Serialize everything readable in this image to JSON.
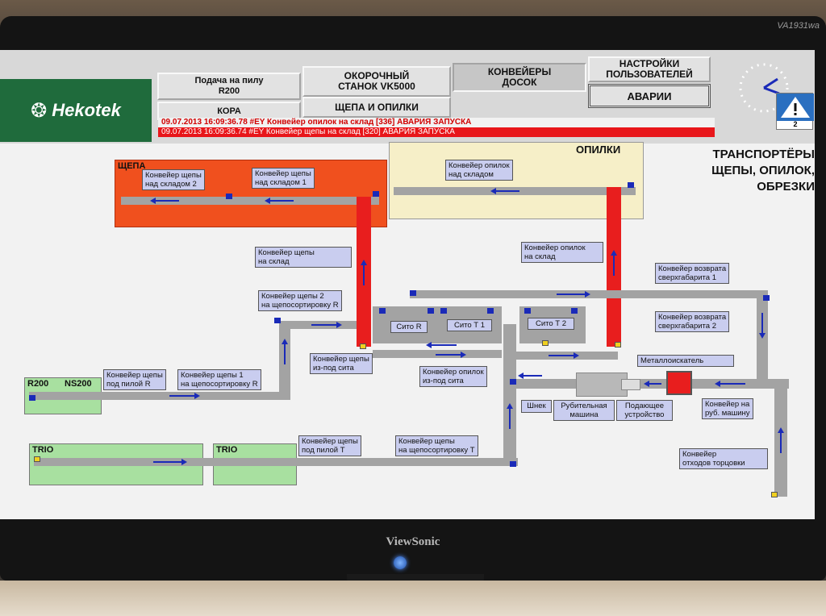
{
  "monitor": {
    "model": "VA1931wa",
    "brand": "ViewSonic"
  },
  "logo": {
    "text": "Hekotek",
    "icon": "hekotek-logo-mark"
  },
  "nav": {
    "feed_saw": "Подача на пилу\nR200",
    "debarker": "ОКОРОЧНЫЙ\nСТАНОК VK5000",
    "board_conveyors": "КОНВЕЙЕРЫ\nДОСОК",
    "user_settings": "НАСТРОЙКИ\nПОЛЬЗОВАТЕЛЕЙ",
    "bark": "КОРА",
    "chips_sawdust": "ЩЕПА И ОПИЛКИ",
    "alarms": "АВАРИИ"
  },
  "warning": {
    "icon": "warning-triangle-icon",
    "count": "2"
  },
  "alarms_list": [
    "09.07.2013 16:09:36.78 #EY Конвейер опилок на склад [336] АВАРИЯ ЗАПУСКА",
    "09.07.2013 16:09:36.74 #EY Конвейер щепы на склад [320] АВАРИЯ ЗАПУСКА"
  ],
  "title": "ТРАНСПОРТЁРЫ\nЩЕПЫ, ОПИЛОК,\nОБРЕЗКИ",
  "zones": {
    "chips": "ЩЕПА",
    "sawdust": "ОПИЛКИ",
    "r200": "R200",
    "ns200": "NS200",
    "trio1": "TRIO",
    "trio2": "TRIO"
  },
  "labels": {
    "chips_over_store2": "Конвейер щепы\nнад складом 2",
    "chips_over_store1": "Конвейер щепы\nнад складом 1",
    "sawdust_over_store": "Конвейер опилок\nнад складом",
    "chips_to_store": "Конвейер щепы\nна склад",
    "sawdust_to_store": "Конвейер опилок\nна склад",
    "chips2_to_sort_r": "Конвейер щепы 2\nна щепосортировку R",
    "return_oversize1": "Конвейер возврата\nсверхгабарита 1",
    "return_oversize2": "Конвейер возврата\nсверхгабарита 2",
    "sieve_r": "Сито R",
    "sieve_t1": "Сито Т 1",
    "sieve_t2": "Сито Т 2",
    "chips_from_sieve": "Конвейер щепы\nиз-под сита",
    "sawdust_from_sieve": "Конвейер опилок\nиз-под сита",
    "metal_detector": "Металлоискатель",
    "chips_under_saw_r": "Конвейер щепы\nпод пилой R",
    "chips1_to_sort_r": "Конвейер щепы 1\nна щепосортировку R",
    "auger": "Шнек",
    "chipper": "Рубительная\nмашина",
    "feeder": "Подающее\nустройство",
    "to_chipper": "Конвейер на\nруб. машину",
    "chips_under_saw_t": "Конвейер щепы\nпод пилой Т",
    "chips_to_sort_t": "Конвейер щепы\nна щепосортировку Т",
    "trim_waste": "Конвейер\nотходов торцовки"
  },
  "colors": {
    "chips_zone": "#f0501e",
    "sawdust_zone": "#f6efc8",
    "saw_zone": "#a8e0a0",
    "belt": "#a3a3a3",
    "belt_alarm": "#e81e1e",
    "flow_arrow": "#1a2ab8"
  }
}
